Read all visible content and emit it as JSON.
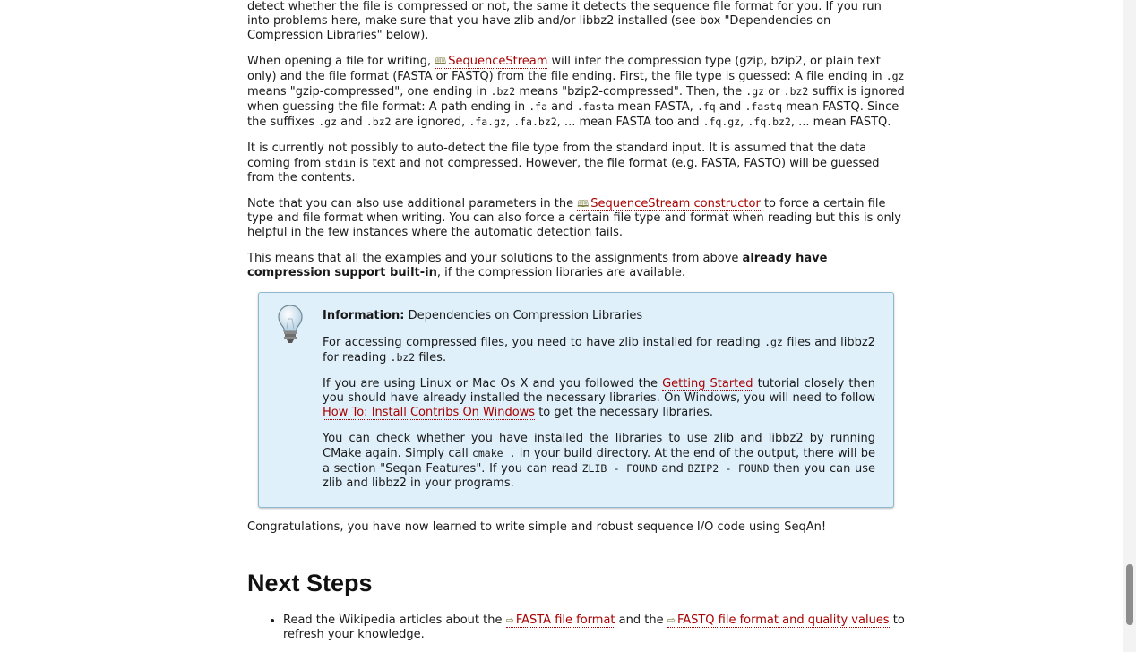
{
  "p1": {
    "t1": "detect whether the file is compressed or not, the same it detects the sequence file format for you. If you run into problems here, make sure that you have zlib and/or libbz2 installed (see box \"Dependencies on Compression Libraries\" below)."
  },
  "p2": {
    "t1": "When opening a file for writing, ",
    "link": "SequenceStream",
    "t2": " will infer the compression type (gzip, bzip2, or plain text only) and the file format (FASTA or FASTQ) from the file ending. First, the file type is guessed: A file ending in ",
    "c1": ".gz",
    "t3": " means \"gzip-compressed\", one ending in ",
    "c2": ".bz2",
    "t4": " means \"bzip2-compressed\". Then, the ",
    "c3": ".gz",
    "t5": " or ",
    "c4": ".bz2",
    "t6": " suffix is ignored when guessing the file format: A path ending in ",
    "c5": ".fa",
    "t7": " and ",
    "c6": ".fasta",
    "t8": " mean FASTA, ",
    "c7": ".fq",
    "t9": " and ",
    "c8": ".fastq",
    "t10": " mean FASTQ. Since the suffixes ",
    "c9": ".gz",
    "t11": " and ",
    "c10": ".bz2",
    "t12": " are ignored, ",
    "c11": ".fa.gz",
    "t13": ", ",
    "c12": ".fa.bz2",
    "t14": ", ... mean FASTA too and ",
    "c13": ".fq.gz",
    "t15": ", ",
    "c14": ".fq.bz2",
    "t16": ", ... mean FASTQ."
  },
  "p3": {
    "t1": "It is currently not possibly to auto-detect the file type from the standard input. It is assumed that the data coming from ",
    "c1": "stdin",
    "t2": " is text and not compressed. However, the file format (e.g. FASTA, FASTQ) will be guessed from the contents."
  },
  "p4": {
    "t1": "Note that you can also use additional parameters in the ",
    "link": "SequenceStream constructor",
    "t2": " to force a certain file type and file format when writing. You can also force a certain file type and format when reading but this is only helpful in the few instances where the automatic detection fails."
  },
  "p5": {
    "t1": "This means that all the examples and your solutions to the assignments from above ",
    "bold": "already have compression support built-in",
    "t2": ", if the compression libraries are available."
  },
  "info": {
    "label": "Information:",
    "title": " Dependencies on Compression Libraries",
    "b1": {
      "t1": "For accessing compressed files, you need to have zlib installed for reading ",
      "c1": ".gz",
      "t2": " files and libbz2 for reading ",
      "c2": ".bz2",
      "t3": " files."
    },
    "b2": {
      "t1": "If you are using Linux or Mac Os X and you followed the ",
      "link1": "Getting Started",
      "t2": " tutorial closely then you should have already installed the necessary libraries. On Windows, you will need to follow ",
      "link2": "How To: Install Contribs On Windows",
      "t3": " to get the necessary libraries."
    },
    "b3": {
      "t1": "You can check whether you have installed the libraries to use zlib and libbz2 by running CMake again. Simply call ",
      "c1": "cmake .",
      "t2": " in your build directory. At the end of the output, there will be a section \"Seqan Features\". If you can read ",
      "c2": "ZLIB - FOUND",
      "t3": " and ",
      "c3": "BZIP2 - FOUND",
      "t4": " then you can use zlib and libbz2 in your programs."
    }
  },
  "p6": {
    "t1": "Congratulations, you have now learned to write simple and robust sequence I/O code using SeqAn!"
  },
  "next": {
    "heading": "Next Steps",
    "item1": {
      "t1": "Read the Wikipedia articles about the ",
      "link1": "FASTA file format",
      "t2": " and the ",
      "link2": "FASTQ file format and quality values",
      "t3": " to refresh your knowledge."
    }
  },
  "icons": {
    "book": "book-icon",
    "external": "external-link-icon",
    "info": "lightbulb-icon"
  },
  "colors": {
    "link": "#a80000",
    "info_bg": "#dff0fa",
    "info_border": "#8fb7cf"
  }
}
